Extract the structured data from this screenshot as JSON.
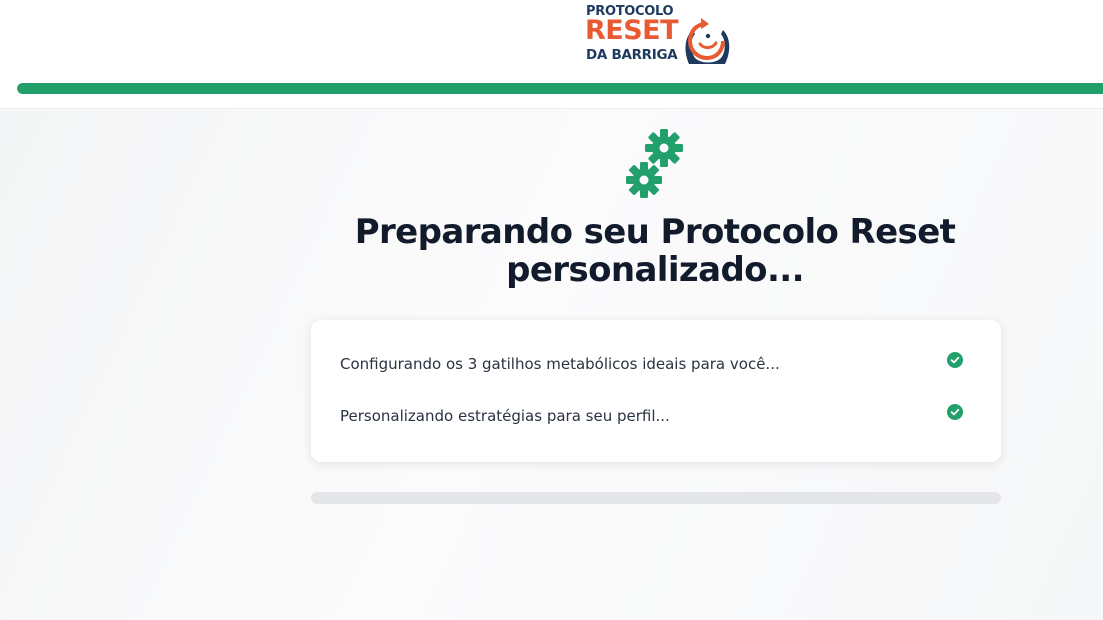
{
  "brand": {
    "line1": "PROTOCOLO",
    "line2": "RESET",
    "line3": "DA BARRIGA",
    "logo_icon": "belly-reset-icon",
    "colors": {
      "navy": "#1f3a5f",
      "orange": "#e85a32"
    }
  },
  "top_progress": {
    "fraction": 1.0,
    "color": "#22a06b"
  },
  "loader": {
    "icon": "gears-icon",
    "title": "Preparando seu Protocolo Reset personalizado...",
    "steps": [
      {
        "label": "Configurando os 3 gatilhos metabólicos ideais para você...",
        "status": "done",
        "icon": "check-circle-icon"
      },
      {
        "label": "Personalizando estratégias para seu perfil...",
        "status": "done",
        "icon": "check-circle-icon"
      }
    ]
  },
  "bottom_progress": {
    "fraction": 0.0,
    "color": "#22a06b"
  },
  "colors": {
    "accent": "#22a06b",
    "title": "#121b2c",
    "track": "#e4e6ea"
  }
}
